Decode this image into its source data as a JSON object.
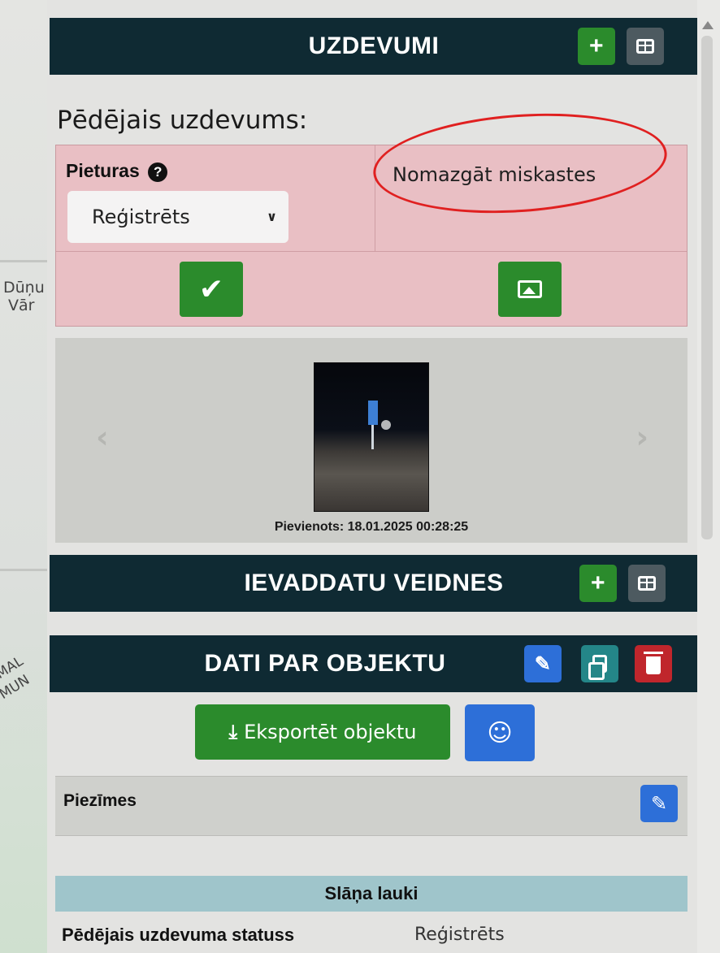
{
  "map": {
    "labels": [
      "Dūņu",
      "Vār",
      "MAL",
      "MUN"
    ]
  },
  "tasks_section": {
    "title": "UZDEVUMI",
    "add_icon": "plus-icon",
    "table_icon": "table-icon"
  },
  "last_task": {
    "label": "Pēdējais uzdevums:",
    "stop_label": "Pieturas",
    "help_icon": "question-circle-icon",
    "status_value": "Reģistrēts",
    "task_text": "Nomazgāt miskastes",
    "complete_icon": "check-icon",
    "photo_icon": "image-icon"
  },
  "gallery": {
    "prev": "‹",
    "next": "›",
    "caption": "Pievienots: 18.01.2025 00:28:25"
  },
  "input_templates_section": {
    "title": "IEVADDATU VEIDNES"
  },
  "object_data_section": {
    "title": "DATI PAR OBJEKTU",
    "edit_icon": "edit-icon",
    "copy_icon": "copy-icon",
    "delete_icon": "trash-icon"
  },
  "actions": {
    "export_label": "Eksportēt objektu",
    "export_icon": "download-icon",
    "waze_icon": "waze-icon"
  },
  "notes": {
    "label": "Piezīmes"
  },
  "layer_fields": {
    "title": "Slāņa lauki",
    "rows": [
      {
        "key": "Pēdējais uzdevuma statuss",
        "value": "Reģistrēts"
      }
    ]
  },
  "colors": {
    "header_bg": "#0f2a33",
    "green": "#2b8b2c",
    "blue": "#2d6fd8",
    "red": "#c0262c",
    "task_card_bg": "#e9bfc4",
    "layer_bar_bg": "#9fc5cb"
  }
}
